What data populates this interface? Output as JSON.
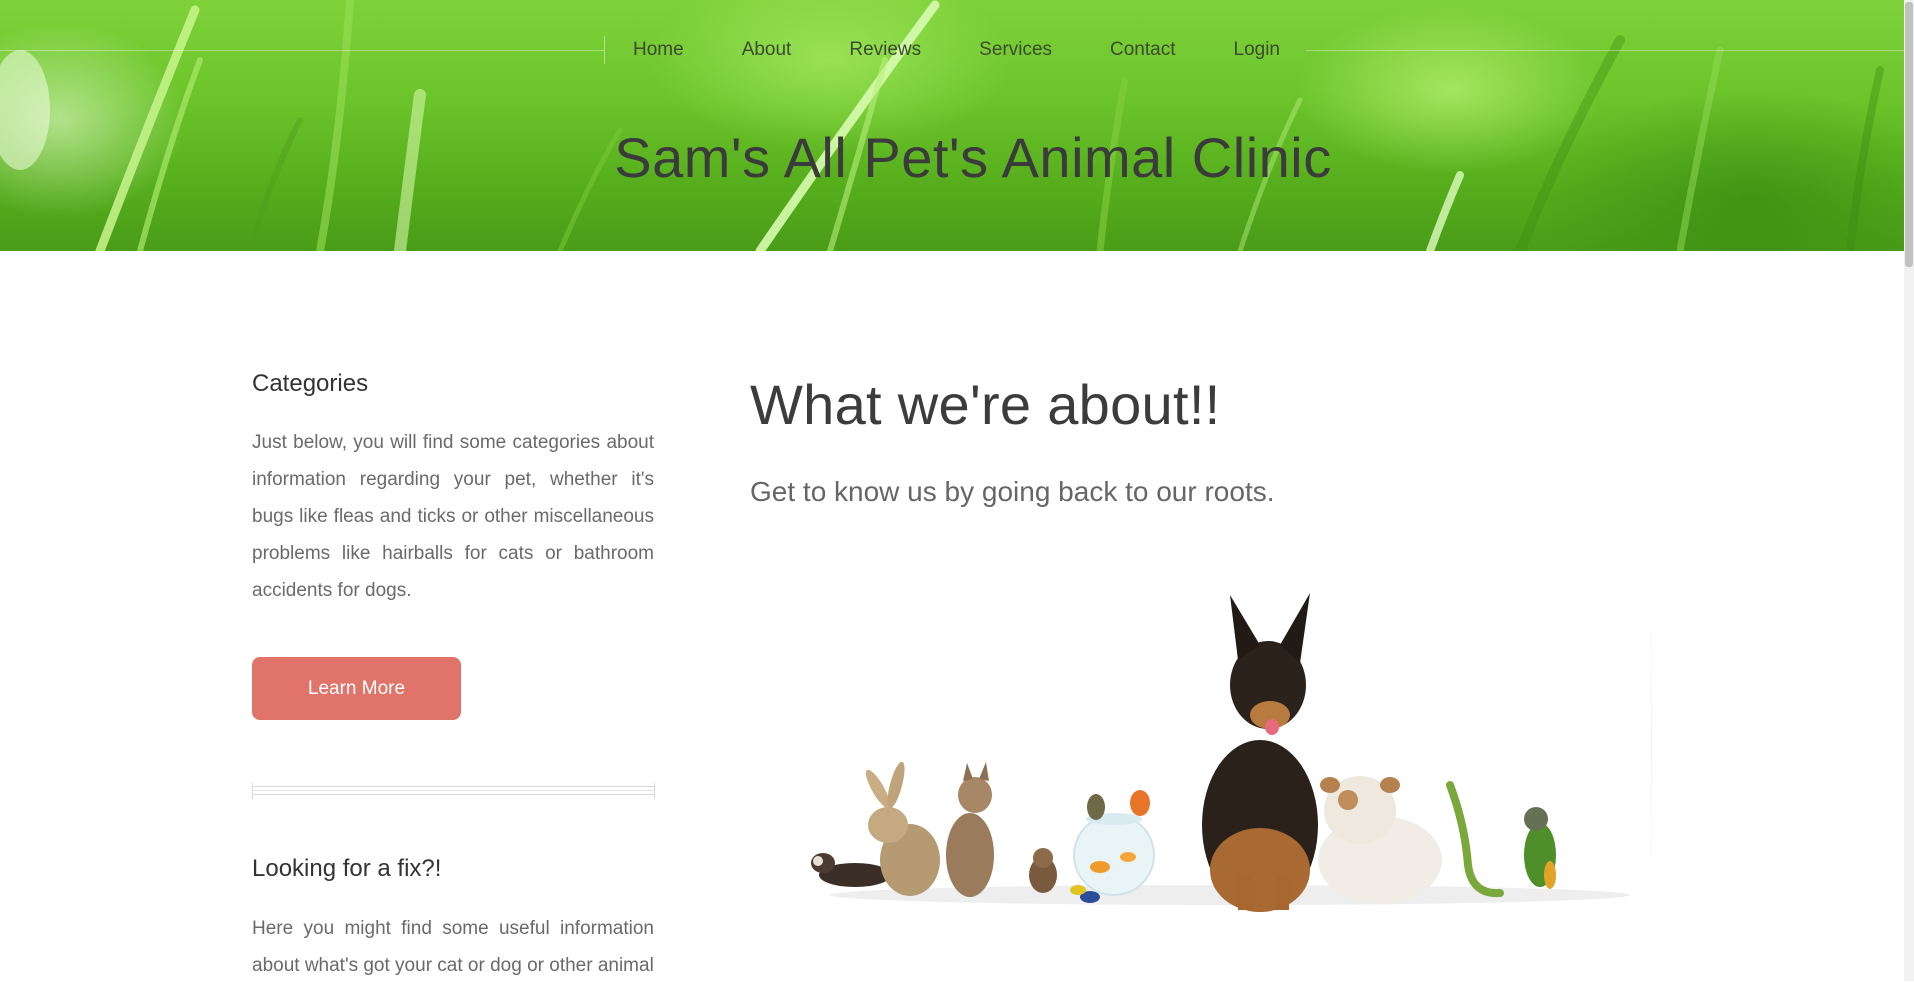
{
  "nav": {
    "items": [
      "Home",
      "About",
      "Reviews",
      "Services",
      "Contact",
      "Login"
    ]
  },
  "header": {
    "title": "Sam's All Pet's Animal Clinic"
  },
  "sidebar": {
    "categories": {
      "title": "Categories",
      "text": "Just below, you will find some categories about information regarding your pet, whether it's bugs like fleas and ticks or other miscellaneous problems like hairballs for cats or bathroom accidents for dogs.",
      "button_label": "Learn More"
    },
    "fix": {
      "title": "Looking for a fix?!",
      "text": "Here you might find some useful information about what's got your cat or dog or other animal"
    }
  },
  "main": {
    "title": "What we're about!!",
    "subtitle": "Get to know us by going back to our roots."
  },
  "colors": {
    "accent_button": "#e0736a",
    "hero_green": "#6bc42a",
    "text_dark": "#3c3c3c",
    "text_muted": "#6a6a6a"
  },
  "icons": {
    "hero_background": "grass-image",
    "main_image": "pets-group-image"
  }
}
